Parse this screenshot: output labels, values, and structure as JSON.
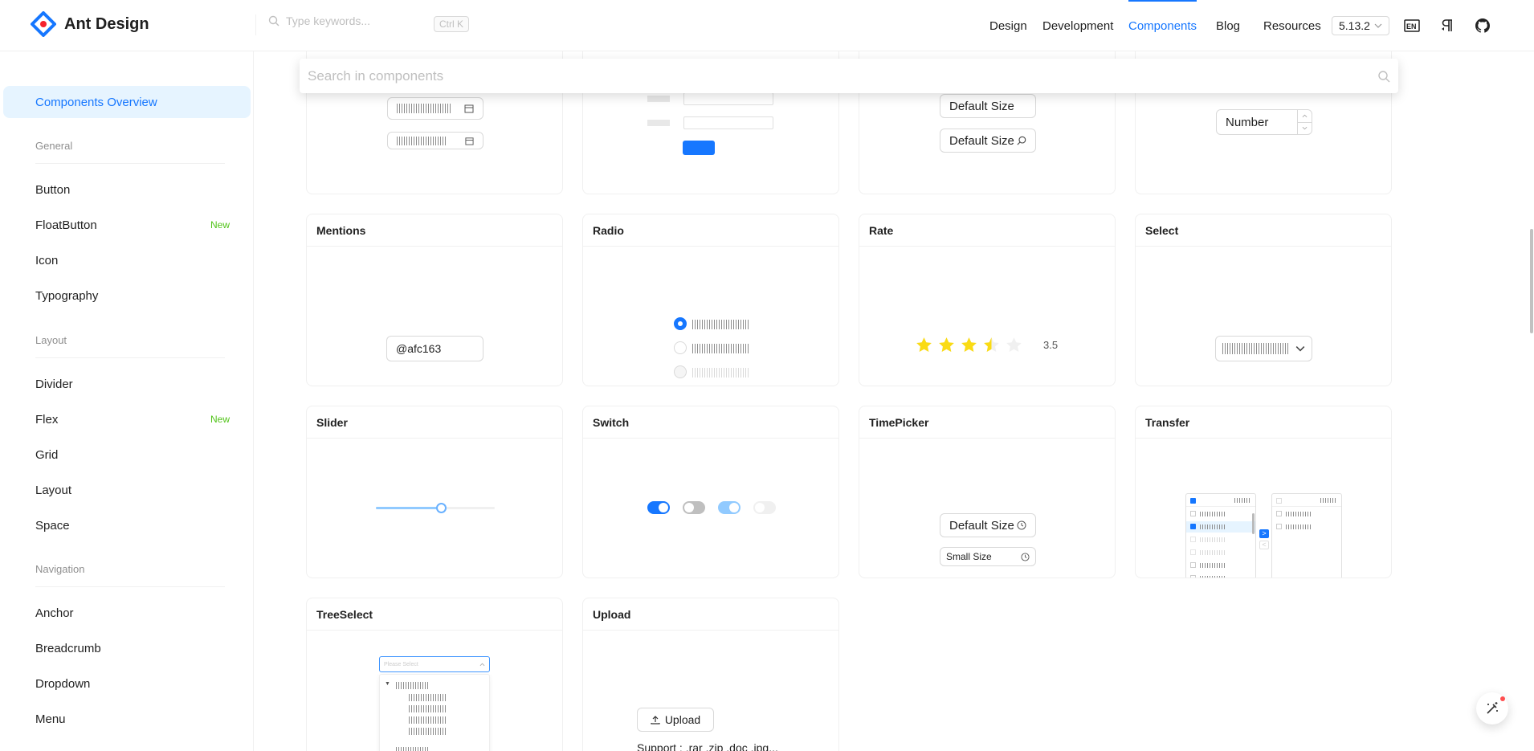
{
  "app": {
    "title": "Ant Design"
  },
  "header": {
    "search_placeholder": "Type keywords...",
    "shortcut": "Ctrl K",
    "nav": [
      "Design",
      "Development",
      "Components",
      "Blog",
      "Resources"
    ],
    "version": "5.13.2",
    "icons": [
      "language-switch-icon",
      "rtl-direction-icon",
      "github-icon"
    ]
  },
  "overlay_search": {
    "placeholder": "Search in components"
  },
  "sidebar": {
    "active": "Components Overview",
    "groups": [
      "General",
      "Layout",
      "Navigation"
    ],
    "items": [
      "Button",
      "FloatButton",
      "Icon",
      "Typography",
      "Divider",
      "Flex",
      "Grid",
      "Layout",
      "Space",
      "Anchor",
      "Breadcrumb",
      "Dropdown",
      "Menu"
    ],
    "new_tag": "New"
  },
  "cards": {
    "input": {
      "default_size": "Default Size",
      "search_size": "Default Size"
    },
    "input_number": {
      "value": "Number"
    },
    "mentions": {
      "title": "Mentions",
      "value": "@afc163"
    },
    "radio": {
      "title": "Radio"
    },
    "rate": {
      "title": "Rate",
      "value": "3.5",
      "rating": 3.5,
      "max": 5
    },
    "select": {
      "title": "Select"
    },
    "slider": {
      "title": "Slider",
      "value": 0.55
    },
    "switch": {
      "title": "Switch"
    },
    "timepicker": {
      "title": "TimePicker",
      "default": "Default Size",
      "small": "Small Size"
    },
    "transfer": {
      "title": "Transfer"
    },
    "treeselect": {
      "title": "TreeSelect",
      "placeholder": "Please Select"
    },
    "upload": {
      "title": "Upload",
      "button": "Upload",
      "hint": "Support : .rar .zip .doc .jpg..."
    }
  },
  "colors": {
    "primary": "#1677ff",
    "star": "#fadb14",
    "new_tag": "#52c41a"
  }
}
